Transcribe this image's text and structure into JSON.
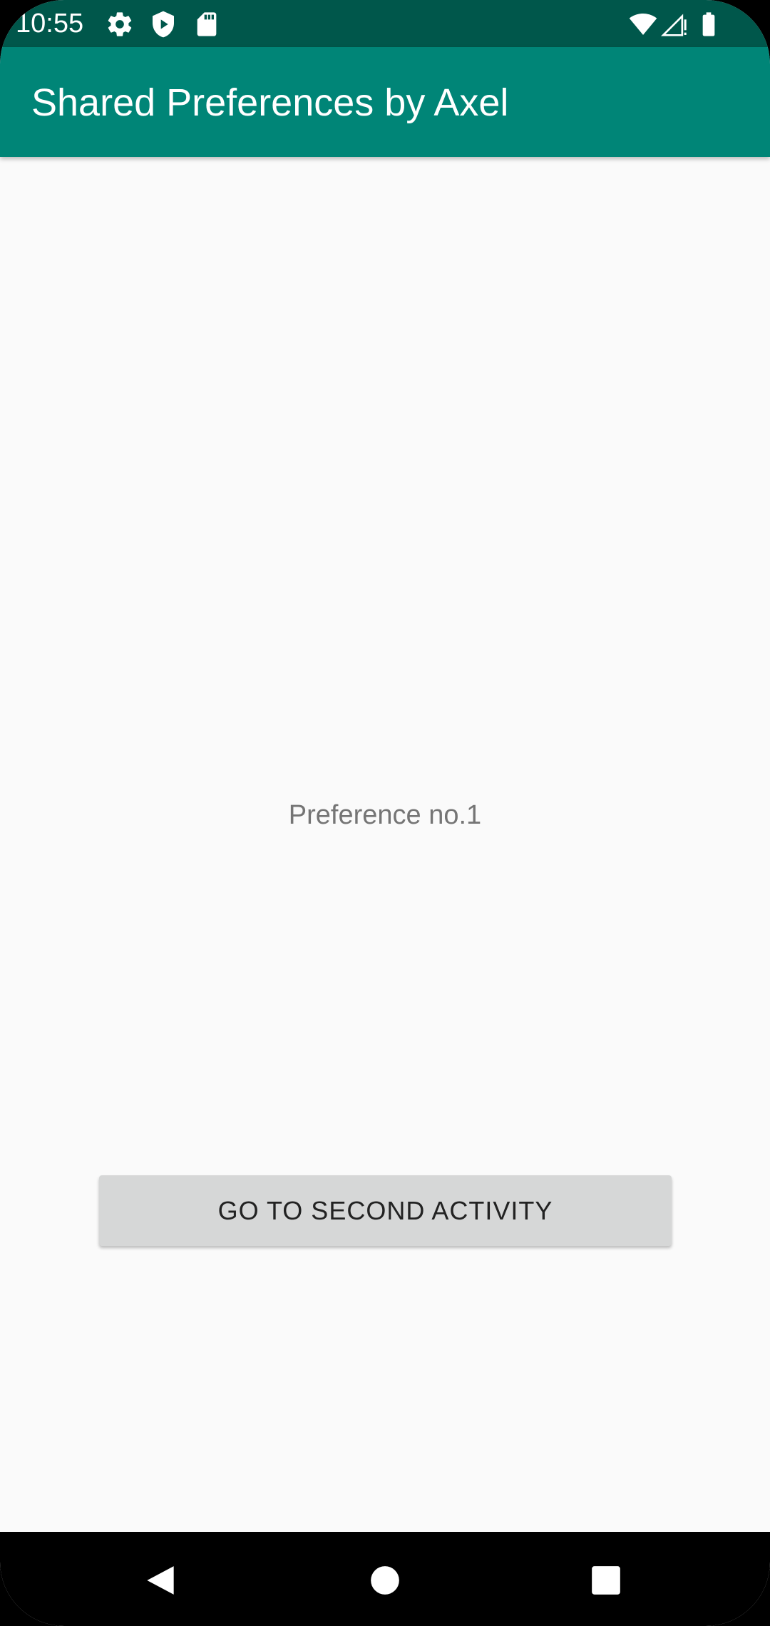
{
  "status_bar": {
    "time": "10:55",
    "icons_left": [
      "gear-icon",
      "shield-play-icon",
      "sd-card-icon"
    ],
    "icons_right": [
      "wifi-icon",
      "signal-no-service-icon",
      "battery-icon"
    ],
    "background_color": "#00574b"
  },
  "app_bar": {
    "title": "Shared Preferences by Axel",
    "background_color": "#008577"
  },
  "main": {
    "preference_text": "Preference no.1",
    "button_label": "GO TO SECOND ACTIVITY"
  },
  "nav_bar": {
    "buttons": [
      "back-icon",
      "home-icon",
      "recents-icon"
    ]
  }
}
